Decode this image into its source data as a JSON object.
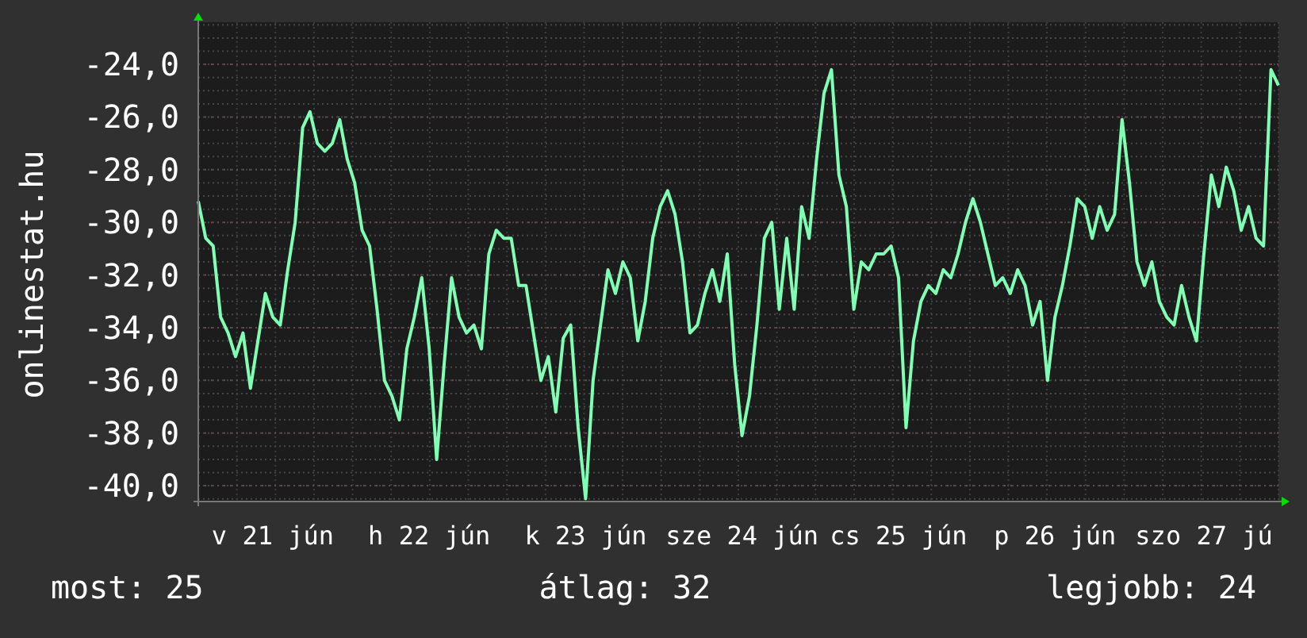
{
  "chart": {
    "chart_data": {
      "type": "line",
      "ylabel": "onlinestat.hu",
      "grid": true,
      "ylim": [
        -40.6,
        -22.4
      ],
      "yticks": [
        {
          "value": -24,
          "label": "-24,0"
        },
        {
          "value": -26,
          "label": "-26,0"
        },
        {
          "value": -28,
          "label": "-28,0"
        },
        {
          "value": -30,
          "label": "-30,0"
        },
        {
          "value": -32,
          "label": "-32,0"
        },
        {
          "value": -34,
          "label": "-34,0"
        },
        {
          "value": -36,
          "label": "-36,0"
        },
        {
          "value": -38,
          "label": "-38,0"
        },
        {
          "value": -40,
          "label": "-40,0"
        }
      ],
      "categories": [
        null,
        null,
        null,
        null,
        null,
        null,
        null,
        null,
        null,
        null,
        "v 21 jún",
        null,
        null,
        null,
        null,
        null,
        null,
        null,
        null,
        null,
        null,
        null,
        null,
        null,
        null,
        null,
        null,
        null,
        null,
        null,
        null,
        "h 22 jún",
        null,
        null,
        null,
        null,
        null,
        null,
        null,
        null,
        null,
        null,
        null,
        null,
        null,
        null,
        null,
        null,
        null,
        null,
        null,
        null,
        "k 23 jún",
        null,
        null,
        null,
        null,
        null,
        null,
        null,
        null,
        null,
        null,
        null,
        null,
        null,
        null,
        null,
        null,
        null,
        null,
        null,
        null,
        "sze 24 jún",
        null,
        null,
        null,
        null,
        null,
        null,
        null,
        null,
        null,
        null,
        null,
        null,
        null,
        null,
        null,
        null,
        null,
        null,
        null,
        null,
        "cs 25 jún",
        null,
        null,
        null,
        null,
        null,
        null,
        null,
        null,
        null,
        null,
        null,
        null,
        null,
        null,
        null,
        null,
        null,
        null,
        null,
        null,
        "p 26 jún",
        null,
        null,
        null,
        null,
        null,
        null,
        null,
        null,
        null,
        null,
        null,
        null,
        null,
        null,
        null,
        null,
        null,
        null,
        null,
        "szo 27 jú",
        null,
        null,
        null,
        null,
        null,
        null,
        null,
        null,
        null,
        null
      ],
      "series": [
        {
          "color": "#80ffb4",
          "values": [
            -29.2,
            -30.6,
            -30.9,
            -33.6,
            -34.2,
            -35.1,
            -34.2,
            -36.3,
            -34.5,
            -32.7,
            -33.6,
            -33.9,
            -31.8,
            -30.0,
            -26.4,
            -25.8,
            -27.0,
            -27.3,
            -27.0,
            -26.1,
            -27.6,
            -28.5,
            -30.3,
            -30.9,
            -33.3,
            -36.0,
            -36.6,
            -37.5,
            -34.8,
            -33.6,
            -32.1,
            -34.8,
            -39.0,
            -35.4,
            -32.1,
            -33.6,
            -34.2,
            -33.9,
            -34.8,
            -31.2,
            -30.3,
            -30.6,
            -30.6,
            -32.4,
            -32.4,
            -34.2,
            -36.0,
            -35.1,
            -37.2,
            -34.4,
            -33.9,
            -37.8,
            -40.5,
            -36.0,
            -33.9,
            -31.8,
            -32.7,
            -31.5,
            -32.1,
            -34.5,
            -33.0,
            -30.6,
            -29.4,
            -28.8,
            -29.7,
            -31.5,
            -34.2,
            -33.9,
            -32.7,
            -31.8,
            -33.0,
            -31.2,
            -35.4,
            -38.1,
            -36.6,
            -33.9,
            -30.6,
            -30.0,
            -33.3,
            -30.6,
            -33.3,
            -29.4,
            -30.6,
            -27.6,
            -25.1,
            -24.2,
            -28.2,
            -29.4,
            -33.3,
            -31.5,
            -31.8,
            -31.2,
            -31.2,
            -30.9,
            -32.1,
            -37.8,
            -34.5,
            -33.0,
            -32.4,
            -32.7,
            -31.8,
            -32.1,
            -31.2,
            -30.0,
            -29.1,
            -30.0,
            -31.2,
            -32.4,
            -32.1,
            -32.7,
            -31.8,
            -32.4,
            -33.9,
            -33.0,
            -36.0,
            -33.6,
            -32.4,
            -30.9,
            -29.1,
            -29.4,
            -30.6,
            -29.4,
            -30.3,
            -29.7,
            -26.1,
            -28.5,
            -31.5,
            -32.4,
            -31.5,
            -33.0,
            -33.6,
            -33.9,
            -32.4,
            -33.6,
            -34.5,
            -31.2,
            -28.2,
            -29.4,
            -27.9,
            -28.8,
            -30.3,
            -29.4,
            -30.6,
            -30.9,
            -24.2,
            -24.8
          ]
        }
      ]
    }
  },
  "stats": [
    "most: 25",
    "átlag: 32",
    "legjobb: 24"
  ]
}
